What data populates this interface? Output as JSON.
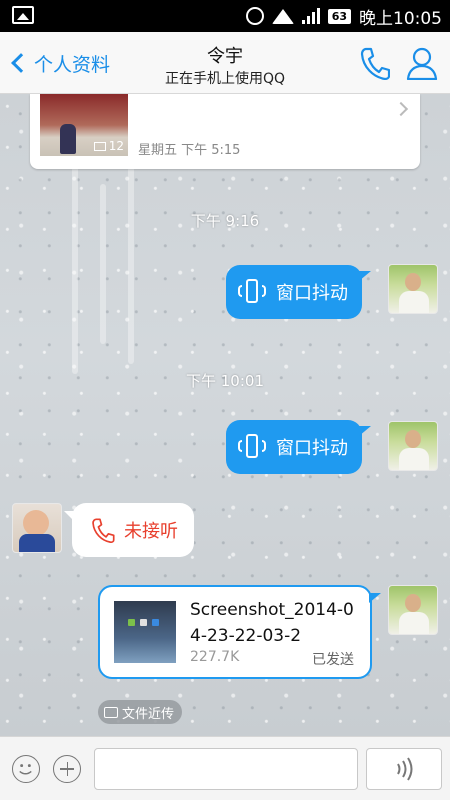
{
  "status_bar": {
    "battery": "63",
    "time": "晚上10:05"
  },
  "header": {
    "back_label": "个人资料",
    "contact_name": "令宇",
    "contact_status": "正在手机上使用QQ"
  },
  "photo_card": {
    "count": "12",
    "time": "星期五 下午 5:15"
  },
  "messages": {
    "ts1": "下午 9:16",
    "shake1": "窗口抖动",
    "ts2": "下午 10:01",
    "shake2": "窗口抖动",
    "missed_call": "未接听",
    "file": {
      "name": "Screenshot_2014-04-23-22-03-2",
      "size": "227.7K",
      "status": "已发送"
    },
    "file_tag": "文件近传"
  },
  "input_bar": {
    "placeholder": ""
  },
  "colors": {
    "accent": "#1f9af0",
    "missed": "#e8402e"
  }
}
